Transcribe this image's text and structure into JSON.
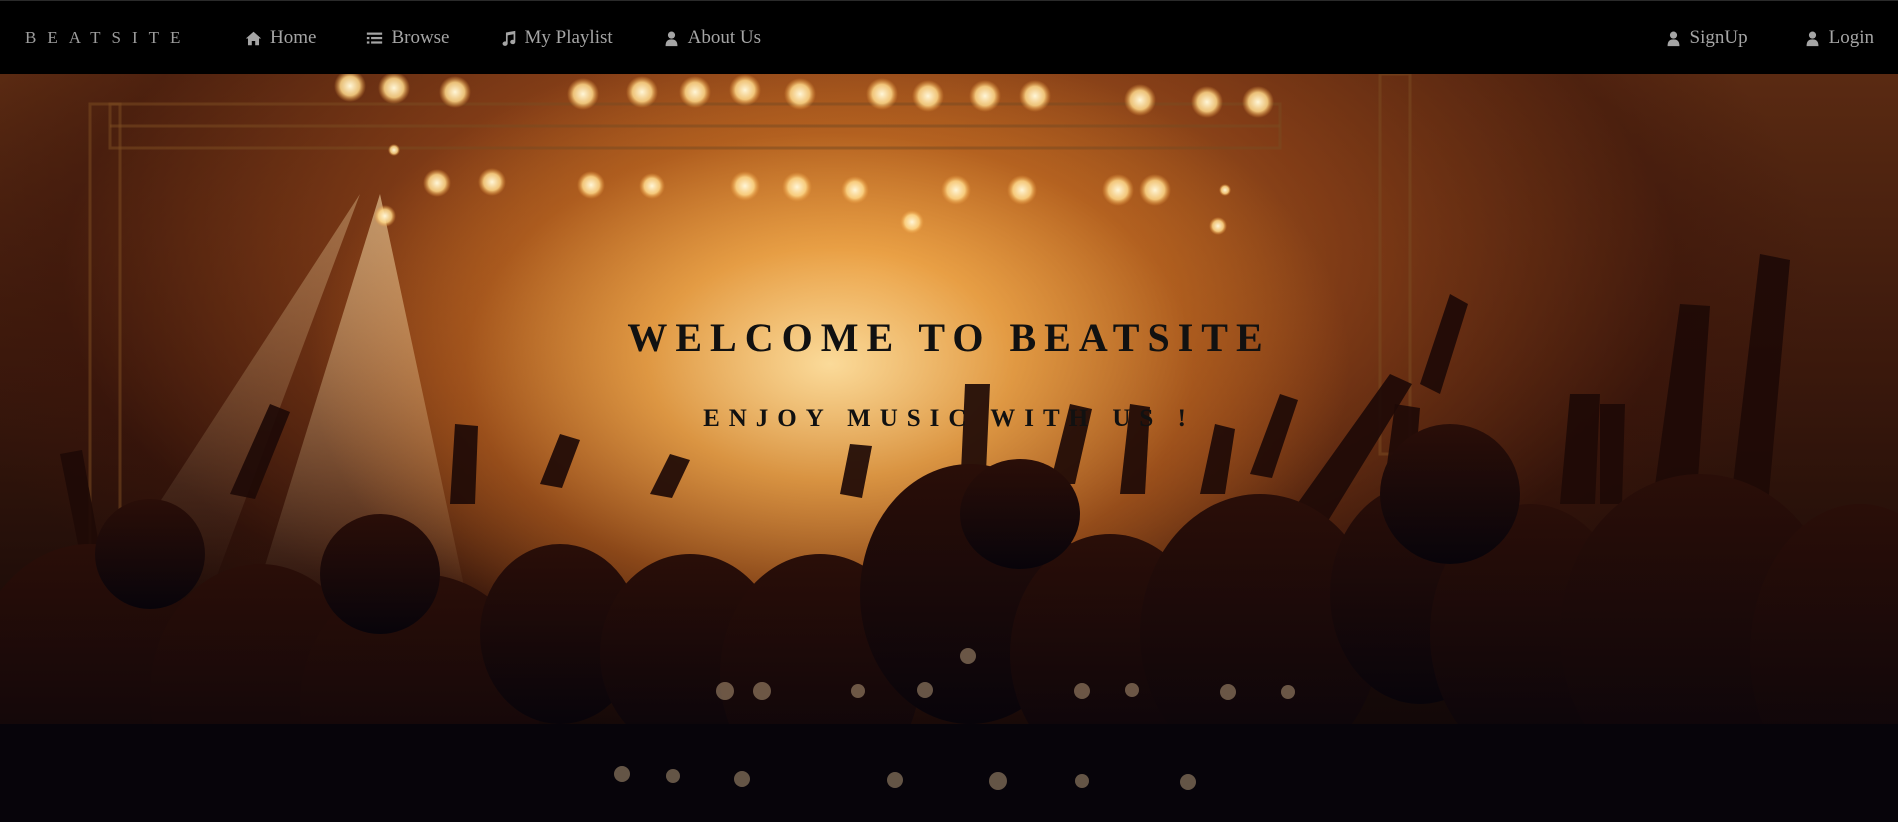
{
  "brand": {
    "name": "BEATSITE"
  },
  "nav": {
    "left": [
      {
        "label": "Home",
        "icon": "home-icon"
      },
      {
        "label": "Browse",
        "icon": "list-icon"
      },
      {
        "label": "My Playlist",
        "icon": "music-note-icon"
      },
      {
        "label": "About Us",
        "icon": "user-icon"
      }
    ],
    "right": [
      {
        "label": "SignUp",
        "icon": "user-icon"
      },
      {
        "label": "Login",
        "icon": "user-icon"
      }
    ]
  },
  "hero": {
    "title": "WELCOME TO BEATSITE",
    "subtitle": "ENJOY MUSIC WITH US !",
    "background": "concert crowd with orange stage lights"
  },
  "colors": {
    "navbar_bg": "#000000",
    "nav_text": "#a5a5a5",
    "hero_glow": "#f5b050",
    "hero_text": "#111111"
  }
}
